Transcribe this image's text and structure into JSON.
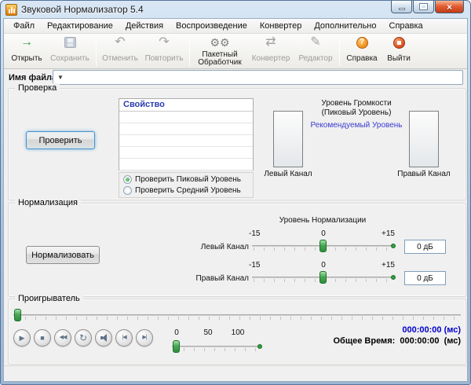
{
  "window": {
    "title": "Звуковой Нормализатор 5.4"
  },
  "menu": {
    "items": [
      "Файл",
      "Редактирование",
      "Действия",
      "Воспроизведение",
      "Конвертер",
      "Дополнительно",
      "Справка"
    ]
  },
  "toolbar": {
    "items": [
      {
        "label": "Открыть",
        "icon": "open-icon",
        "enabled": true
      },
      {
        "label": "Сохранить",
        "icon": "save-icon",
        "enabled": false
      },
      {
        "label": "Отменить",
        "icon": "undo-icon",
        "enabled": false
      },
      {
        "label": "Повторить",
        "icon": "redo-icon",
        "enabled": false
      },
      {
        "label": "Пакетный Обработчик",
        "icon": "batch-processor-icon",
        "enabled": true
      },
      {
        "label": "Конвертер",
        "icon": "converter-icon",
        "enabled": false
      },
      {
        "label": "Редактор",
        "icon": "editor-icon",
        "enabled": false
      },
      {
        "label": "Справка",
        "icon": "help-icon",
        "enabled": true
      },
      {
        "label": "Выйти",
        "icon": "exit-icon",
        "enabled": true
      }
    ]
  },
  "filename": {
    "label": "Имя файла:",
    "value": ""
  },
  "check": {
    "group_title": "Проверка",
    "button": "Проверить",
    "table": {
      "header": "Свойство",
      "rows": [
        "",
        "",
        "",
        "",
        ""
      ]
    },
    "radios": [
      {
        "label": "Проверить Пиковый Уровень",
        "selected": true
      },
      {
        "label": "Проверить Средний Уровень",
        "selected": false
      }
    ],
    "meter_title": "Уровень Громкости (Пиковый Уровень)",
    "recommended": "Рекомендуемый Уровень",
    "left_channel": "Левый Канал",
    "right_channel": "Правый Канал"
  },
  "normalize": {
    "group_title": "Нормализация",
    "button": "Нормализовать",
    "slider_title": "Уровень Нормализации",
    "scale": {
      "min": "-15",
      "mid": "0",
      "max": "+15"
    },
    "left": {
      "label": "Левый Канал",
      "value": "0 дБ"
    },
    "right": {
      "label": "Правый Канал",
      "value": "0 дБ"
    }
  },
  "player": {
    "group_title": "Проигрыватель",
    "buttons": [
      "play",
      "stop",
      "rewind",
      "repeat",
      "volume",
      "previous",
      "next"
    ],
    "volume_scale": [
      "0",
      "50",
      "100"
    ],
    "current_time": "000:00:00",
    "current_time_unit": "(мс)",
    "total_time_label": "Общее Время:",
    "total_time": "000:00:00",
    "total_time_unit": "(мс)"
  },
  "colors": {
    "table_header": "#2a3cb0",
    "recommended_link": "#3c3ccf",
    "current_time": "#0000cc",
    "slider_accent": "#2f9e3f"
  }
}
